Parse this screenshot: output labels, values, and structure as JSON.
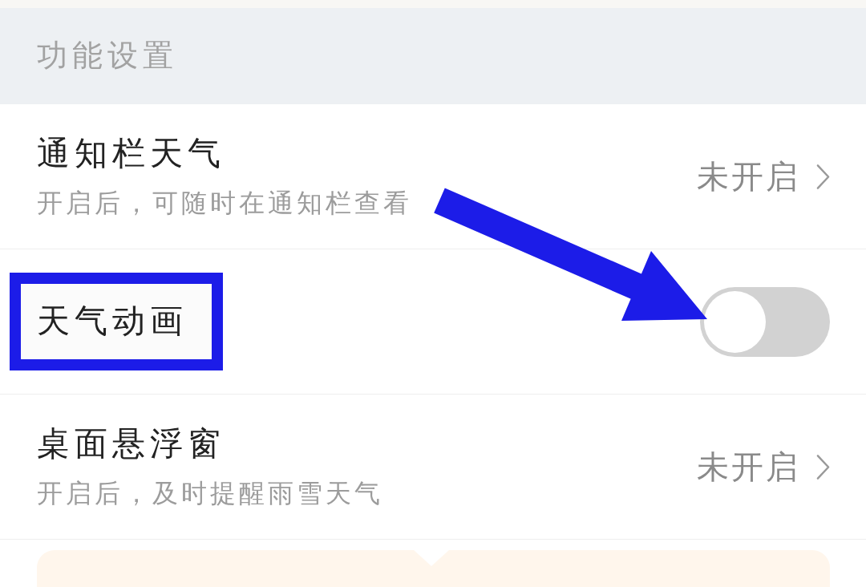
{
  "section": {
    "title": "功能设置"
  },
  "settings": [
    {
      "kind": "link",
      "title": "通知栏天气",
      "subtitle": "开启后，可随时在通知栏查看",
      "value": "未开启",
      "highlighted": false
    },
    {
      "kind": "toggle",
      "title": "天气动画",
      "on": false,
      "highlighted": true
    },
    {
      "kind": "link",
      "title": "桌面悬浮窗",
      "subtitle": "开启后，及时提醒雨雪天气",
      "value": "未开启",
      "highlighted": false
    }
  ]
}
